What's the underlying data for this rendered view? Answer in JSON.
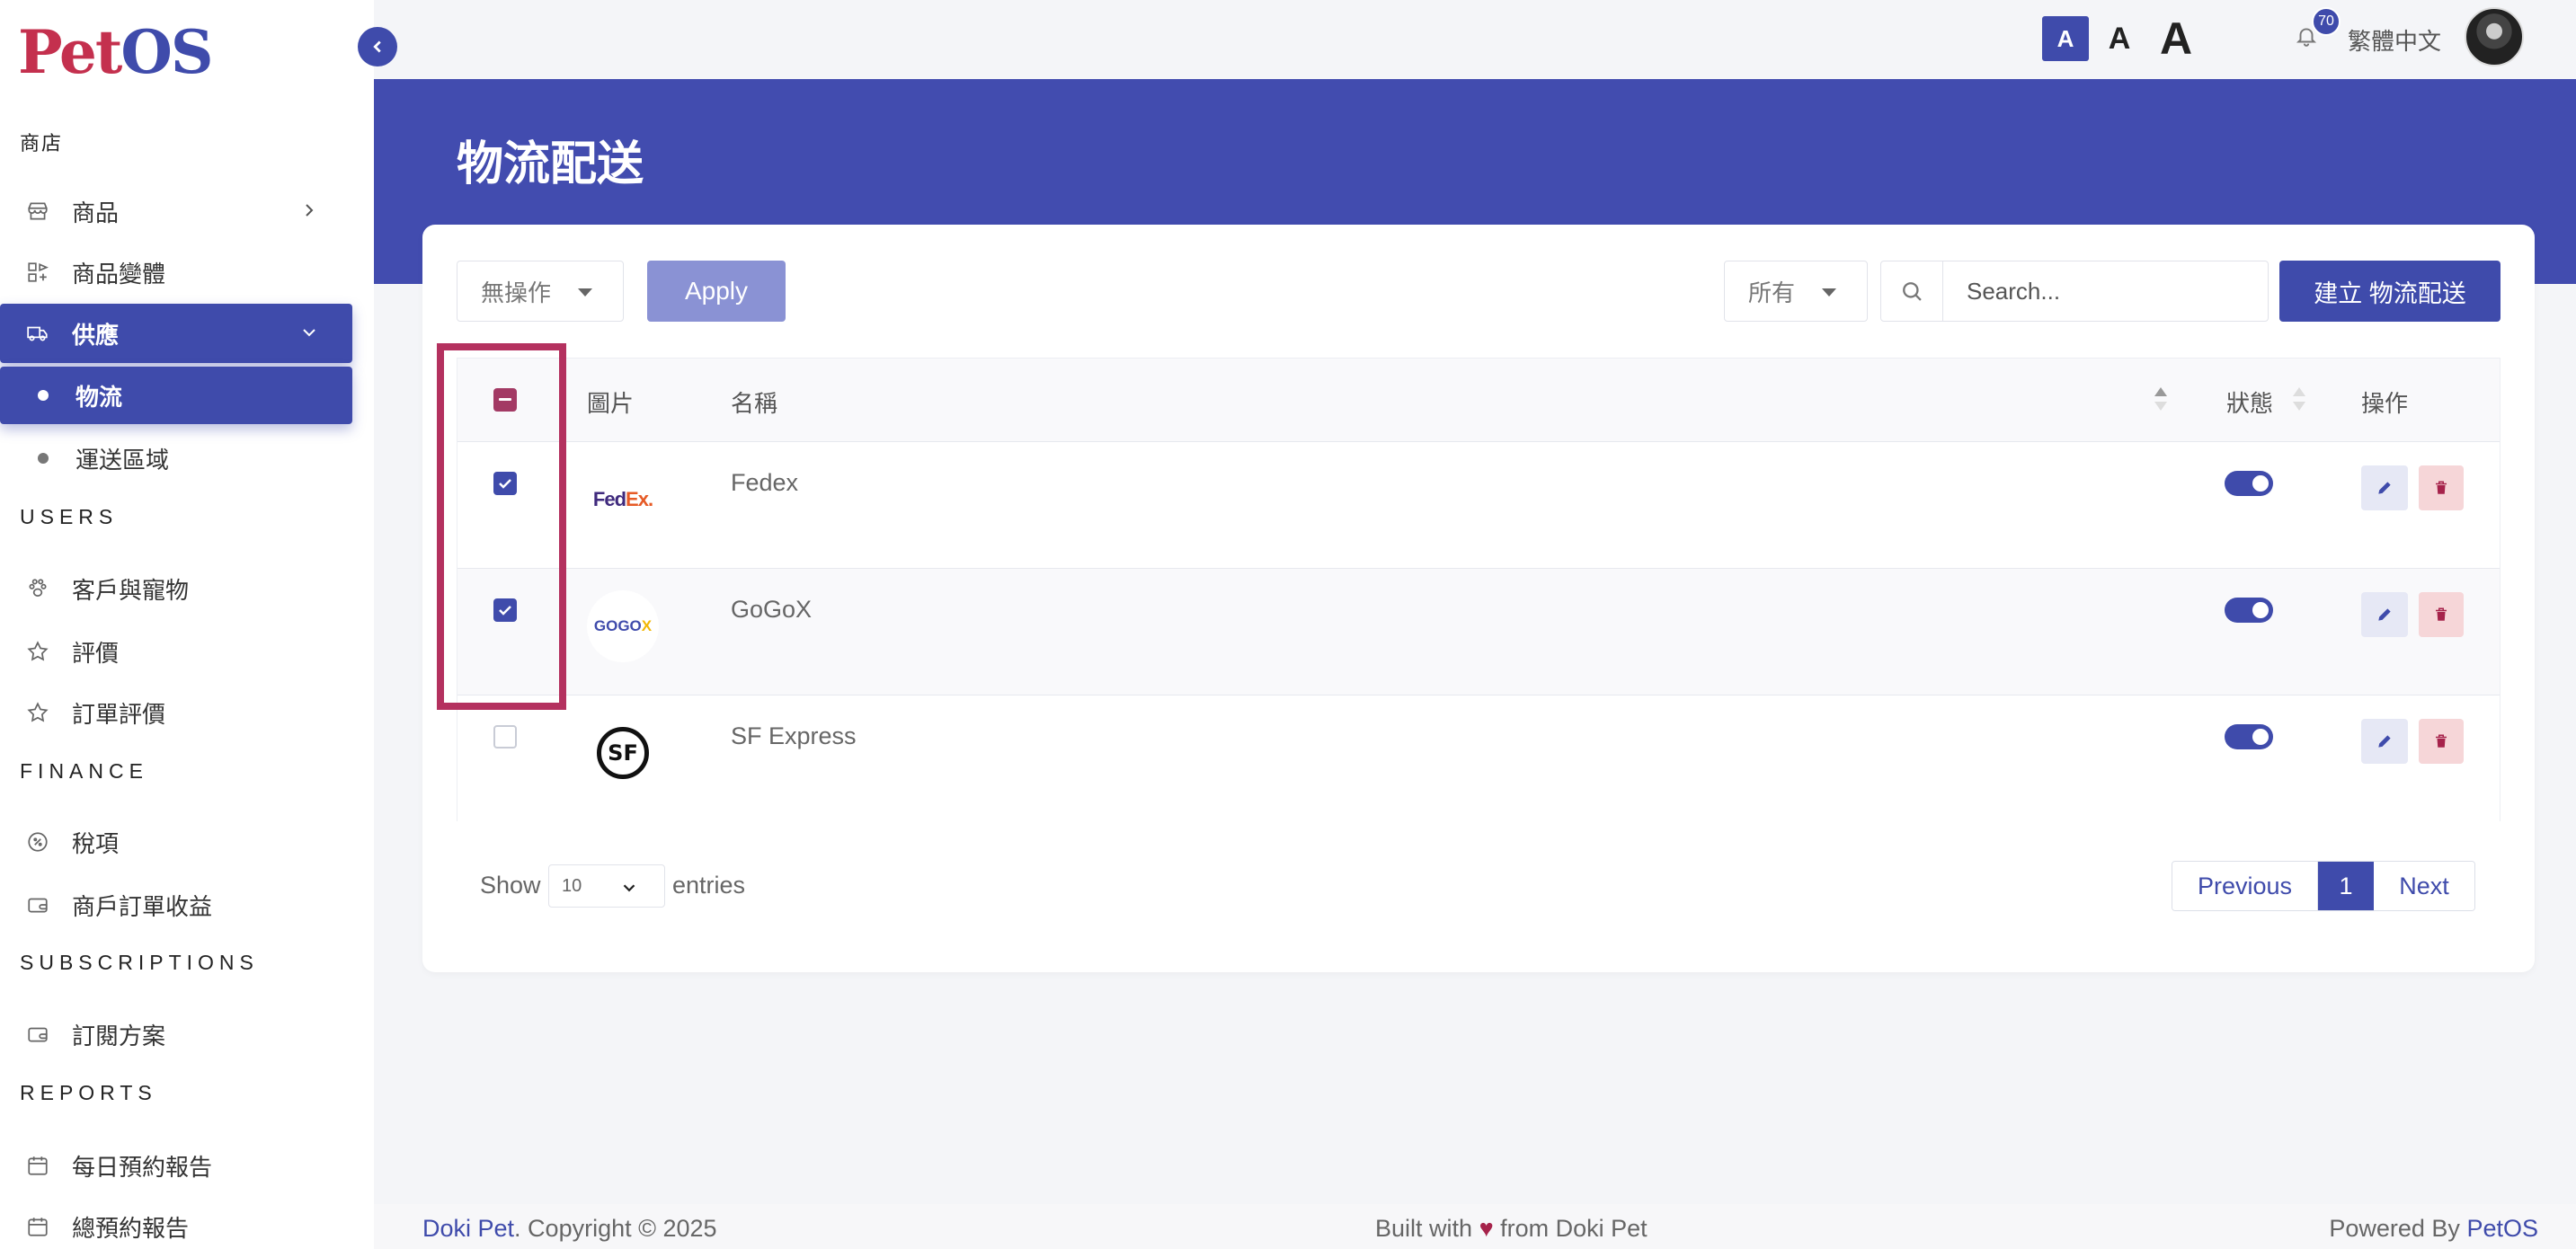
{
  "brand": {
    "part1": "Pet",
    "part2": "OS"
  },
  "sidebar": {
    "sections": {
      "shop": "商店",
      "users": "USERS",
      "finance": "FINANCE",
      "subscriptions": "SUBSCRIPTIONS",
      "reports": "REPORTS"
    },
    "items": {
      "products": "商品",
      "variants": "商品變體",
      "supply": "供應",
      "logistics": "物流",
      "delivery_zones": "運送區域",
      "customers_pets": "客戶與寵物",
      "reviews": "評價",
      "order_reviews": "訂單評價",
      "tax": "稅項",
      "merchant_revenue": "商戶訂單收益",
      "plans": "訂閱方案",
      "daily_report": "每日預約報告",
      "total_report": "總預約報告"
    }
  },
  "topbar": {
    "font_small": "A",
    "font_medium": "A",
    "font_large": "A",
    "notification_count": "70",
    "language": "繁體中文"
  },
  "page": {
    "title": "物流配送"
  },
  "toolbar": {
    "bulk_action": "無操作",
    "apply": "Apply",
    "filter": "所有",
    "search_placeholder": "Search...",
    "create": "建立 物流配送"
  },
  "table": {
    "headers": {
      "image": "圖片",
      "name": "名稱",
      "status": "狀態",
      "actions": "操作"
    },
    "rows": [
      {
        "name": "Fedex",
        "logo_text": "FedEx.",
        "checked": true,
        "status": true
      },
      {
        "name": "GoGoX",
        "logo_text": "GOGOX",
        "checked": true,
        "status": true
      },
      {
        "name": "SF Express",
        "logo_text": "SF",
        "checked": false,
        "status": true
      }
    ]
  },
  "pagination": {
    "show": "Show",
    "entries_value": "10",
    "entries": "entries",
    "previous": "Previous",
    "current": "1",
    "next": "Next"
  },
  "footer": {
    "company": "Doki Pet",
    "copyright": ". Copyright © 2025",
    "built_prefix": "Built with",
    "heart": "♥",
    "built_suffix": "from Doki Pet",
    "powered_prefix": "Powered By",
    "powered_brand": "PetOS"
  },
  "colors": {
    "primary": "#3f4bab",
    "banner": "#424caf",
    "highlight": "#b4315f",
    "danger": "#a6234b"
  }
}
